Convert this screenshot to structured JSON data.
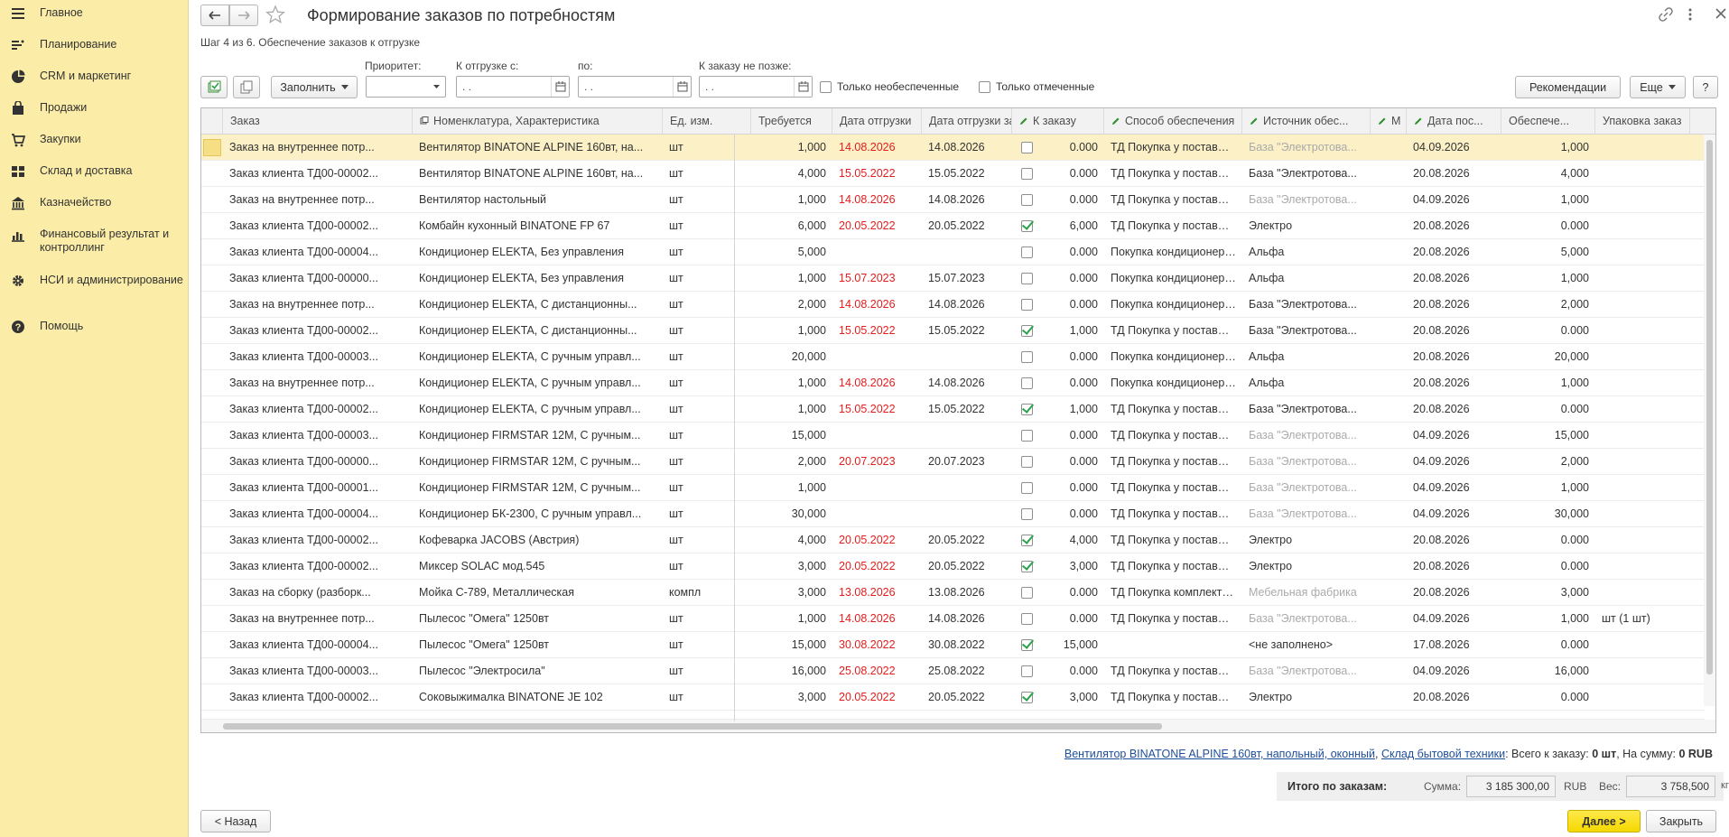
{
  "sidebar": {
    "items": [
      {
        "label": "Главное",
        "icon": "menu-icon"
      },
      {
        "label": "Планирование",
        "icon": "planning-icon"
      },
      {
        "label": "CRM и маркетинг",
        "icon": "pie-icon"
      },
      {
        "label": "Продажи",
        "icon": "bag-icon"
      },
      {
        "label": "Закупки",
        "icon": "cart-icon"
      },
      {
        "label": "Склад и доставка",
        "icon": "warehouse-icon"
      },
      {
        "label": "Казначейство",
        "icon": "treasury-icon"
      },
      {
        "label": "Финансовый результат и контроллинг",
        "icon": "chart-icon"
      },
      {
        "label": "НСИ и администрирование",
        "icon": "gear-icon"
      },
      {
        "label": "Помощь",
        "icon": "help-icon"
      }
    ]
  },
  "header": {
    "title": "Формирование заказов по потребностям",
    "subtitle": "Шаг 4 из 6. Обеспечение заказов к отгрузке"
  },
  "toolbar": {
    "fill_label": "Заполнить",
    "priority_label": "Приоритет:",
    "priority_value": "",
    "ship_from_label": "К отгрузке с:",
    "ship_from_value": " .  .",
    "to_label": "по:",
    "to_value": " .  .",
    "order_by_label": "К заказу не позже:",
    "order_by_value": " .  .",
    "only_unprovided": "Только необеспеченные",
    "only_marked": "Только отмеченные",
    "recommendations": "Рекомендации",
    "more": "Еще",
    "help": "?"
  },
  "table": {
    "columns": [
      "Заказ",
      "Номенклатура, Характеристика",
      "Ед. изм.",
      "Требуется",
      "Дата отгрузки",
      "Дата отгрузки заказа",
      "К заказу",
      "Способ обеспечения",
      "Источник обес...",
      "М",
      "Дата пос...",
      "Обеспече...",
      "Упаковка заказ"
    ],
    "rows": [
      {
        "order": "Заказ на внутреннее потр...",
        "item": "Вентилятор BINATONE ALPINE 160вт, на...",
        "unit": "шт",
        "req": "1,000",
        "ship": "14.08.2026",
        "ship_red": true,
        "order_ship": "14.08.2026",
        "checked": false,
        "qty": "0.000",
        "method": "ТД Покупка у поставщи...",
        "source": "База \"Электротова...",
        "source_gray": true,
        "date": "04.09.2026",
        "provided": "1,000",
        "pack": "",
        "sel": true
      },
      {
        "order": "Заказ клиента ТД00-00002...",
        "item": "Вентилятор BINATONE ALPINE 160вт, на...",
        "unit": "шт",
        "req": "4,000",
        "ship": "15.05.2022",
        "ship_red": true,
        "order_ship": "15.05.2022",
        "checked": false,
        "qty": "0.000",
        "method": "ТД Покупка у поставщи...",
        "source": "База \"Электротова...",
        "source_gray": false,
        "date": "20.08.2026",
        "provided": "4,000",
        "pack": ""
      },
      {
        "order": "Заказ на внутреннее потр...",
        "item": "Вентилятор настольный",
        "unit": "шт",
        "req": "1,000",
        "ship": "14.08.2026",
        "ship_red": true,
        "order_ship": "14.08.2026",
        "checked": false,
        "qty": "0.000",
        "method": "ТД Покупка у поставщи...",
        "source": "База \"Электротова...",
        "source_gray": true,
        "date": "04.09.2026",
        "provided": "1,000",
        "pack": ""
      },
      {
        "order": "Заказ клиента ТД00-00002...",
        "item": "Комбайн кухонный BINATONE FP 67",
        "unit": "шт",
        "req": "6,000",
        "ship": "20.05.2022",
        "ship_red": true,
        "order_ship": "20.05.2022",
        "checked": true,
        "qty": "6,000",
        "method": "ТД Покупка у поставщи...",
        "source": "Электро",
        "source_gray": false,
        "date": "20.08.2026",
        "provided": "0.000",
        "pack": ""
      },
      {
        "order": "Заказ клиента ТД00-00004...",
        "item": "Кондиционер ELEKTA, Без управления",
        "unit": "шт",
        "req": "5,000",
        "ship": "",
        "ship_red": false,
        "order_ship": "",
        "checked": false,
        "qty": "0.000",
        "method": "Покупка кондиционеров...",
        "source": "Альфа",
        "source_gray": false,
        "date": "20.08.2026",
        "provided": "5,000",
        "pack": ""
      },
      {
        "order": "Заказ клиента ТД00-00000...",
        "item": "Кондиционер ELEKTA, Без управления",
        "unit": "шт",
        "req": "1,000",
        "ship": "15.07.2023",
        "ship_red": true,
        "order_ship": "15.07.2023",
        "checked": false,
        "qty": "0.000",
        "method": "Покупка кондиционеров...",
        "source": "Альфа",
        "source_gray": false,
        "date": "20.08.2026",
        "provided": "1,000",
        "pack": ""
      },
      {
        "order": "Заказ на внутреннее потр...",
        "item": "Кондиционер ELEKTA, С дистанционны...",
        "unit": "шт",
        "req": "2,000",
        "ship": "14.08.2026",
        "ship_red": true,
        "order_ship": "14.08.2026",
        "checked": false,
        "qty": "0.000",
        "method": "Покупка кондиционеров...",
        "source": "База \"Электротова...",
        "source_gray": false,
        "date": "20.08.2026",
        "provided": "2,000",
        "pack": ""
      },
      {
        "order": "Заказ клиента ТД00-00002...",
        "item": "Кондиционер ELEKTA, С дистанционны...",
        "unit": "шт",
        "req": "1,000",
        "ship": "15.05.2022",
        "ship_red": true,
        "order_ship": "15.05.2022",
        "checked": true,
        "qty": "1,000",
        "method": "ТД Покупка у поставщи...",
        "source": "База \"Электротова...",
        "source_gray": false,
        "date": "20.08.2026",
        "provided": "0.000",
        "pack": ""
      },
      {
        "order": "Заказ клиента ТД00-00003...",
        "item": "Кондиционер ELEKTA, С ручным управл...",
        "unit": "шт",
        "req": "20,000",
        "ship": "",
        "ship_red": false,
        "order_ship": "",
        "checked": false,
        "qty": "0.000",
        "method": "Покупка кондиционеров...",
        "source": "Альфа",
        "source_gray": false,
        "date": "20.08.2026",
        "provided": "20,000",
        "pack": ""
      },
      {
        "order": "Заказ на внутреннее потр...",
        "item": "Кондиционер ELEKTA, С ручным управл...",
        "unit": "шт",
        "req": "1,000",
        "ship": "14.08.2026",
        "ship_red": true,
        "order_ship": "14.08.2026",
        "checked": false,
        "qty": "0.000",
        "method": "Покупка кондиционеров...",
        "source": "Альфа",
        "source_gray": false,
        "date": "20.08.2026",
        "provided": "1,000",
        "pack": ""
      },
      {
        "order": "Заказ клиента ТД00-00002...",
        "item": "Кондиционер ELEKTA, С ручным управл...",
        "unit": "шт",
        "req": "1,000",
        "ship": "15.05.2022",
        "ship_red": true,
        "order_ship": "15.05.2022",
        "checked": true,
        "qty": "1,000",
        "method": "ТД Покупка у поставщи...",
        "source": "База \"Электротова...",
        "source_gray": false,
        "date": "20.08.2026",
        "provided": "0.000",
        "pack": ""
      },
      {
        "order": "Заказ клиента ТД00-00003...",
        "item": "Кондиционер FIRMSTAR 12M, С ручным...",
        "unit": "шт",
        "req": "15,000",
        "ship": "",
        "ship_red": false,
        "order_ship": "",
        "checked": false,
        "qty": "0.000",
        "method": "ТД Покупка у поставщи...",
        "source": "База \"Электротова...",
        "source_gray": true,
        "date": "04.09.2026",
        "provided": "15,000",
        "pack": ""
      },
      {
        "order": "Заказ клиента ТД00-00000...",
        "item": "Кондиционер FIRMSTAR 12M, С ручным...",
        "unit": "шт",
        "req": "2,000",
        "ship": "20.07.2023",
        "ship_red": true,
        "order_ship": "20.07.2023",
        "checked": false,
        "qty": "0.000",
        "method": "ТД Покупка у поставщи...",
        "source": "База \"Электротова...",
        "source_gray": true,
        "date": "04.09.2026",
        "provided": "2,000",
        "pack": ""
      },
      {
        "order": "Заказ клиента ТД00-00001...",
        "item": "Кондиционер FIRMSTAR 12M, С ручным...",
        "unit": "шт",
        "req": "1,000",
        "ship": "",
        "ship_red": false,
        "order_ship": "",
        "checked": false,
        "qty": "0.000",
        "method": "ТД Покупка у поставщи...",
        "source": "База \"Электротова...",
        "source_gray": true,
        "date": "04.09.2026",
        "provided": "1,000",
        "pack": ""
      },
      {
        "order": "Заказ клиента ТД00-00004...",
        "item": "Кондиционер БК-2300, С ручным управл...",
        "unit": "шт",
        "req": "30,000",
        "ship": "",
        "ship_red": false,
        "order_ship": "",
        "checked": false,
        "qty": "0.000",
        "method": "ТД Покупка у поставщи...",
        "source": "База \"Электротова...",
        "source_gray": true,
        "date": "04.09.2026",
        "provided": "30,000",
        "pack": ""
      },
      {
        "order": "Заказ клиента ТД00-00002...",
        "item": "Кофеварка JACOBS (Австрия)",
        "unit": "шт",
        "req": "4,000",
        "ship": "20.05.2022",
        "ship_red": true,
        "order_ship": "20.05.2022",
        "checked": true,
        "qty": "4,000",
        "method": "ТД Покупка у поставщи...",
        "source": "Электро",
        "source_gray": false,
        "date": "20.08.2026",
        "provided": "0.000",
        "pack": ""
      },
      {
        "order": "Заказ клиента ТД00-00002...",
        "item": "Миксер SOLAC мод.545",
        "unit": "шт",
        "req": "3,000",
        "ship": "20.05.2022",
        "ship_red": true,
        "order_ship": "20.05.2022",
        "checked": true,
        "qty": "3,000",
        "method": "ТД Покупка у поставщи...",
        "source": "Электро",
        "source_gray": false,
        "date": "20.08.2026",
        "provided": "0.000",
        "pack": ""
      },
      {
        "order": "Заказ на сборку (разборк...",
        "item": "Мойка С-789, Металлическая",
        "unit": "компл",
        "req": "3,000",
        "ship": "13.08.2026",
        "ship_red": true,
        "order_ship": "13.08.2026",
        "checked": false,
        "qty": "0.000",
        "method": "ТД Покупка комплектую...",
        "source": "Мебельная фабрика",
        "source_gray": true,
        "date": "20.08.2026",
        "provided": "3,000",
        "pack": ""
      },
      {
        "order": "Заказ на внутреннее потр...",
        "item": "Пылесос \"Омега\" 1250вт",
        "unit": "шт",
        "req": "1,000",
        "ship": "14.08.2026",
        "ship_red": true,
        "order_ship": "14.08.2026",
        "checked": false,
        "qty": "0.000",
        "method": "ТД Покупка у поставщи...",
        "source": "База \"Электротова...",
        "source_gray": true,
        "date": "04.09.2026",
        "provided": "1,000",
        "pack": "шт (1 шт)"
      },
      {
        "order": "Заказ клиента ТД00-00004...",
        "item": "Пылесос \"Омега\" 1250вт",
        "unit": "шт",
        "req": "15,000",
        "ship": "30.08.2022",
        "ship_red": true,
        "order_ship": "30.08.2022",
        "checked": true,
        "qty": "15,000",
        "method": "",
        "source": "<не заполнено>",
        "source_gray": false,
        "date": "17.08.2026",
        "provided": "0.000",
        "pack": ""
      },
      {
        "order": "Заказ клиента ТД00-00003...",
        "item": "Пылесос \"Электросила\"",
        "unit": "шт",
        "req": "16,000",
        "ship": "25.08.2022",
        "ship_red": true,
        "order_ship": "25.08.2022",
        "checked": false,
        "qty": "0.000",
        "method": "ТД Покупка у поставщи...",
        "source": "База \"Электротова...",
        "source_gray": true,
        "date": "04.09.2026",
        "provided": "16,000",
        "pack": ""
      },
      {
        "order": "Заказ клиента ТД00-00002...",
        "item": "Соковыжималка  BINATONE JE 102",
        "unit": "шт",
        "req": "3,000",
        "ship": "20.05.2022",
        "ship_red": true,
        "order_ship": "20.05.2022",
        "checked": true,
        "qty": "3,000",
        "method": "ТД Покупка у поставщи...",
        "source": "Электро",
        "source_gray": false,
        "date": "20.08.2026",
        "provided": "0.000",
        "pack": ""
      }
    ]
  },
  "footer": {
    "item_link": "Вентилятор BINATONE ALPINE 160вт, напольный, оконный",
    "sep": ",",
    "warehouse_link": "Склад бытовой техники",
    "summary_prefix": ": Всего к заказу: ",
    "summary_qty": "0 шт",
    "summary_mid": ", На сумму: ",
    "summary_sum": "0 RUB",
    "totals_label": "Итого по заказам:",
    "sum_label": "Сумма:",
    "sum_value": "3 185 300,00",
    "currency": "RUB",
    "weight_label": "Вес:",
    "weight_value": "3 758,500",
    "weight_unit": "кг",
    "back": "< Назад",
    "next": "Далее >",
    "close": "Закрыть"
  },
  "colors": {
    "sidebar": "#fbeda8",
    "accent": "#f5d800",
    "red": "#e21d1d",
    "link": "#1f4e9a"
  }
}
